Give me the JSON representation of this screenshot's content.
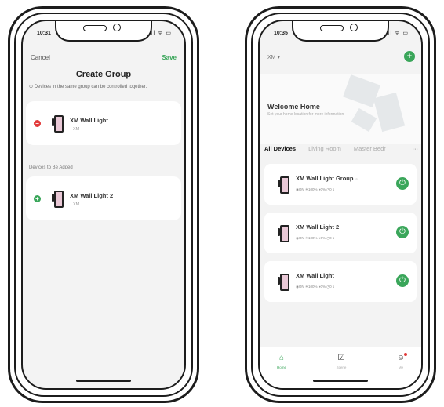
{
  "left": {
    "status_time": "10:31",
    "status_icons": "..ıl ᯤ ▭",
    "cancel": "Cancel",
    "save": "Save",
    "title": "Create Group",
    "info": "Devices in the same group can be controlled together.",
    "group_devices": [
      {
        "name": "XM Wall Light",
        "sub": "XM"
      }
    ],
    "section_label": "Devices to Be Added",
    "available_devices": [
      {
        "name": "XM Wall Light 2",
        "sub": "XM"
      }
    ]
  },
  "right": {
    "status_time": "10:35",
    "status_icons": "..ıl ᯤ ▭",
    "home_name": "XM",
    "welcome_title": "Welcome Home",
    "welcome_sub": "Set your home location for more information",
    "tabs": [
      "All Devices",
      "Living Room",
      "Master Bedr"
    ],
    "tab_more": "···",
    "devices": [
      {
        "name": "XM Wall Light Group",
        "stats": "◉ON  ☀100%  ◑0%  ◷0 s"
      },
      {
        "name": "XM Wall Light 2",
        "stats": "◉ON  ☀100%  ◑0%  ◷0 s"
      },
      {
        "name": "XM Wall Light",
        "stats": "◉ON  ☀100%  ◑0%  ◷0 s"
      }
    ],
    "tabbar": [
      {
        "label": "Home",
        "icon": "home-icon"
      },
      {
        "label": "Scene",
        "icon": "scene-icon"
      },
      {
        "label": "Me",
        "icon": "profile-icon"
      }
    ]
  },
  "colors": {
    "accent": "#3aa65a",
    "danger": "#e23a3a"
  }
}
